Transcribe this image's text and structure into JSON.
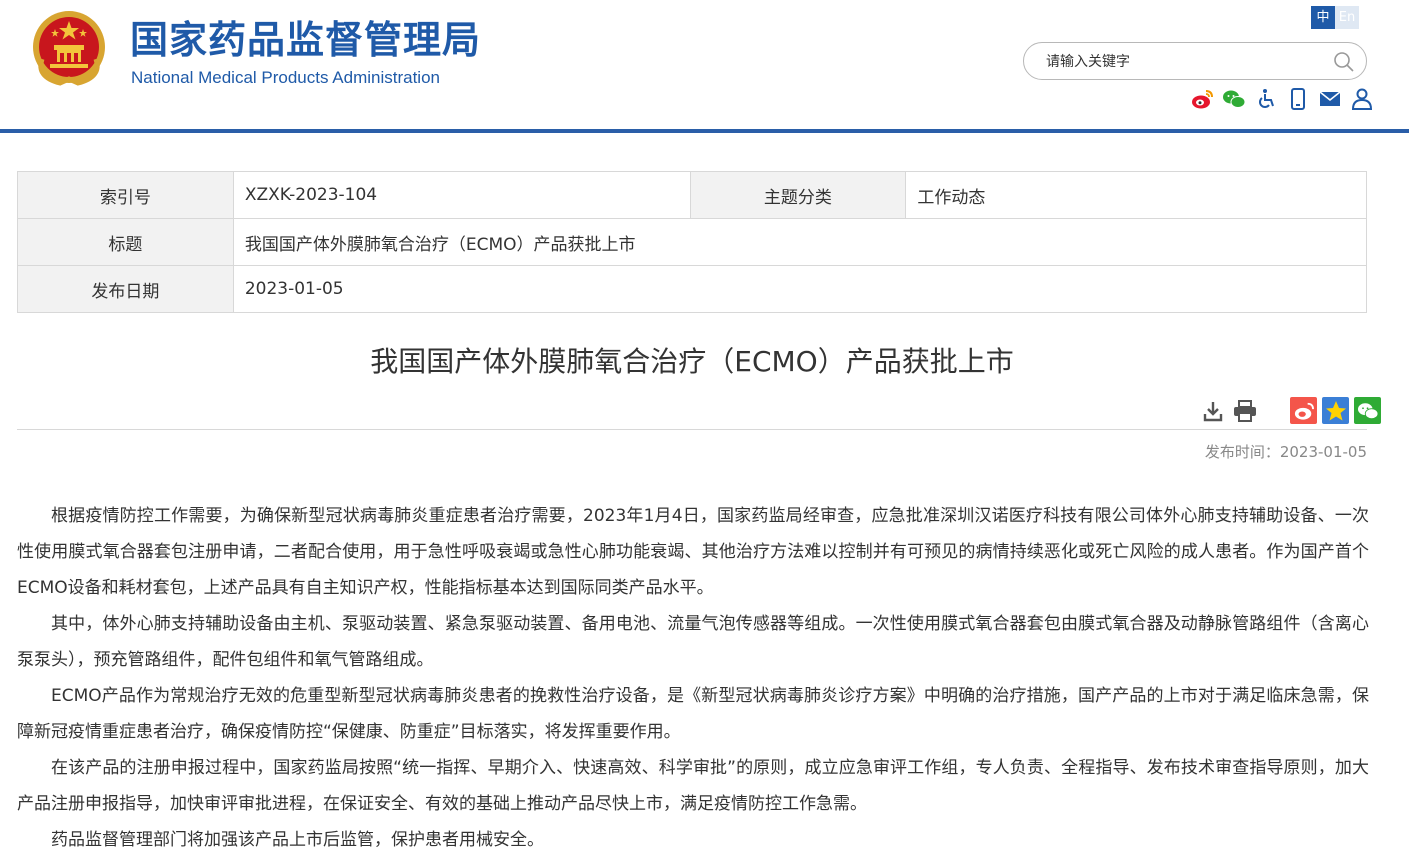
{
  "header": {
    "title_cn": "国家药品监督管理局",
    "title_en": "National Medical Products Administration",
    "lang_cn": "中",
    "lang_en": "En",
    "search_placeholder": "请输入关键字",
    "emblem_icon": "national-emblem-icon",
    "social_icons": [
      "weibo-icon",
      "wechat-icon",
      "accessibility-icon",
      "mobile-icon",
      "email-icon",
      "user-icon"
    ],
    "accent_color": "#1f5aa8"
  },
  "info": {
    "index_label": "索引号",
    "index_value": "XZXK-2023-104",
    "topic_label": "主题分类",
    "topic_value": "工作动态",
    "title_label": "标题",
    "title_value": "我国国产体外膜肺氧合治疗（ECMO）产品获批上市",
    "date_label": "发布日期",
    "date_value": "2023-01-05"
  },
  "article": {
    "title": "我国国产体外膜肺氧合治疗（ECMO）产品获批上市",
    "tools": [
      "download-icon",
      "print-icon"
    ],
    "share": [
      "weibo-share-icon",
      "favorite-share-icon",
      "wechat-share-icon"
    ],
    "pub_time": "发布时间：2023-01-05",
    "paragraphs": [
      "根据疫情防控工作需要，为确保新型冠状病毒肺炎重症患者治疗需要，2023年1月4日，国家药监局经审查，应急批准深圳汉诺医疗科技有限公司体外心肺支持辅助设备、一次性使用膜式氧合器套包注册申请，二者配合使用，用于急性呼吸衰竭或急性心肺功能衰竭、其他治疗方法难以控制并有可预见的病情持续恶化或死亡风险的成人患者。作为国产首个ECMO设备和耗材套包，上述产品具有自主知识产权，性能指标基本达到国际同类产品水平。",
      "其中，体外心肺支持辅助设备由主机、泵驱动装置、紧急泵驱动装置、备用电池、流量气泡传感器等组成。一次性使用膜式氧合器套包由膜式氧合器及动静脉管路组件（含离心泵泵头），预充管路组件，配件包组件和氧气管路组成。",
      "ECMO产品作为常规治疗无效的危重型新型冠状病毒肺炎患者的挽救性治疗设备，是《新型冠状病毒肺炎诊疗方案》中明确的治疗措施，国产产品的上市对于满足临床急需，保障新冠疫情重症患者治疗，确保疫情防控“保健康、防重症”目标落实，将发挥重要作用。",
      "在该产品的注册申报过程中，国家药监局按照“统一指挥、早期介入、快速高效、科学审批”的原则，成立应急审评工作组，专人负责、全程指导、发布技术审查指导原则，加大产品注册申报指导，加快审评审批进程，在保证安全、有效的基础上推动产品尽快上市，满足疫情防控工作急需。",
      "药品监督管理部门将加强该产品上市后监管，保护患者用械安全。"
    ]
  }
}
